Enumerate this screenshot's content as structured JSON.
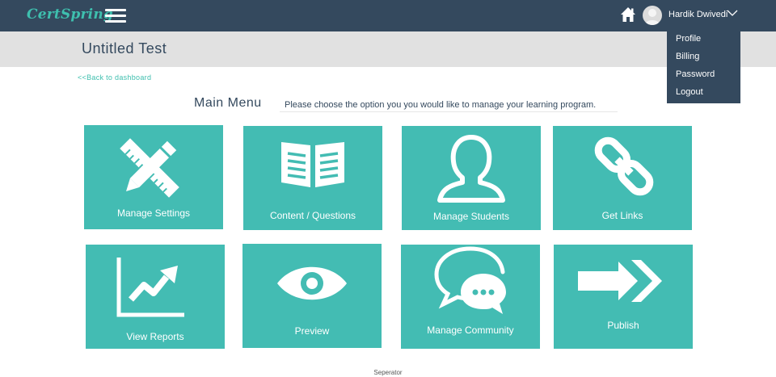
{
  "header": {
    "logo": "CertSpring",
    "user_name": "Hardik Dwivedi",
    "icons": {
      "menu": "hamburger-icon",
      "home": "home-icon",
      "avatar": "user-avatar-icon",
      "caret": "chevron-down-icon"
    }
  },
  "dropdown": {
    "items": [
      {
        "label": "Profile"
      },
      {
        "label": "Billing"
      },
      {
        "label": "Password"
      },
      {
        "label": "Logout"
      }
    ]
  },
  "page": {
    "title": "Untitled Test",
    "back_link": "<<Back to dashboard"
  },
  "menu": {
    "title": "Main Menu",
    "description": "Please choose the option you you would like to manage your learning program."
  },
  "tiles": [
    {
      "label": "Manage Settings",
      "icon": "pencil-ruler-icon"
    },
    {
      "label": "Content / Questions",
      "icon": "open-book-icon"
    },
    {
      "label": "Manage Students",
      "icon": "person-icon"
    },
    {
      "label": "Get Links",
      "icon": "link-icon"
    },
    {
      "label": "View Reports",
      "icon": "line-chart-icon"
    },
    {
      "label": "Preview",
      "icon": "eye-icon"
    },
    {
      "label": "Manage Community",
      "icon": "chat-bubbles-icon"
    },
    {
      "label": "Publish",
      "icon": "arrow-right-icon"
    }
  ],
  "footer": {
    "separator": "Seperator"
  },
  "colors": {
    "navbar": "#34495e",
    "accent": "#3ebfae",
    "tile": "#43bcb3",
    "titlebar": "#e1e1e1"
  }
}
